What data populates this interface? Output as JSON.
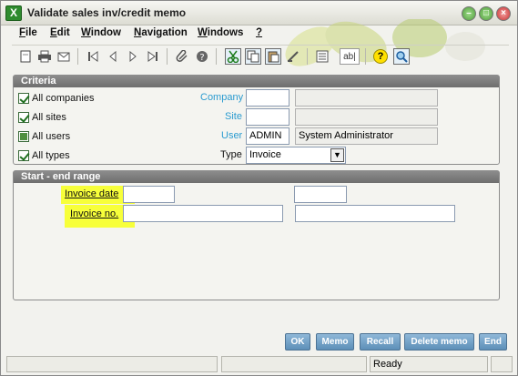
{
  "window": {
    "title": "Validate sales inv/credit memo"
  },
  "menu": [
    {
      "label": "File",
      "u": "F",
      "rest": "ile"
    },
    {
      "label": "Edit",
      "u": "E",
      "rest": "dit"
    },
    {
      "label": "Window",
      "u": "W",
      "rest": "indow"
    },
    {
      "label": "Navigation",
      "u": "N",
      "rest": "avigation"
    },
    {
      "label": "Windows",
      "u": "W",
      "rest": "indows"
    },
    {
      "label": "?",
      "u": "?",
      "rest": ""
    }
  ],
  "toolbar": {
    "text_glyph": "ab|",
    "help_glyph": "?"
  },
  "criteria": {
    "header": "Criteria",
    "all_companies": "All companies",
    "all_sites": "All sites",
    "all_users": "All users",
    "all_types": "All types",
    "company_label": "Company",
    "site_label": "Site",
    "user_label": "User",
    "type_label": "Type",
    "user_value": "ADMIN",
    "user_name": "System Administrator",
    "type_value": "Invoice"
  },
  "range": {
    "header": "Start - end range",
    "invoice_date_label": "Invoice date",
    "invoice_no_label": "Invoice no."
  },
  "buttons": {
    "ok": "OK",
    "memo": "Memo",
    "recall": "Recall",
    "delete_memo": "Delete memo",
    "end": "End"
  },
  "status": {
    "text": "Ready"
  },
  "colors": {
    "accent": "#2a9bd0",
    "highlight": "#f7ff3a",
    "button": "#6f9cc4"
  }
}
